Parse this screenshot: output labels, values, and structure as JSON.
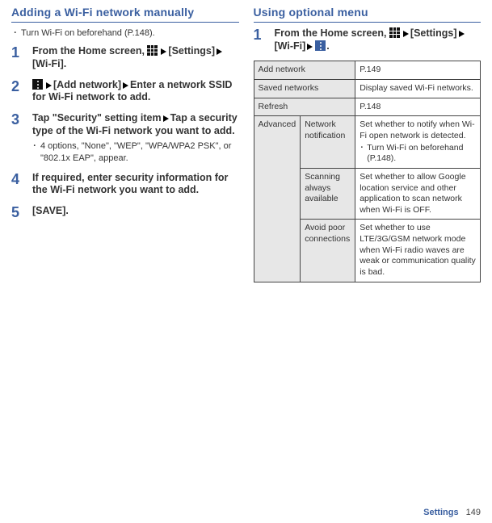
{
  "left": {
    "title": "Adding a Wi-Fi network manually",
    "intro": "Turn Wi-Fi on beforehand (P.148).",
    "steps": [
      {
        "num": "1",
        "fragments": [
          "From the Home screen, ",
          "ICON_GRID",
          "ARROW",
          "[Settings]",
          "ARROW",
          "[Wi-Fi]."
        ]
      },
      {
        "num": "2",
        "fragments": [
          "ICON_MORE",
          "ARROW",
          "[Add network]",
          "ARROW",
          "Enter a network SSID for Wi-Fi network to add."
        ]
      },
      {
        "num": "3",
        "fragments": [
          "Tap \"Security\" setting item",
          "ARROW",
          "Tap a security type of the Wi-Fi network you want to add."
        ],
        "note": "4 options, \"None\", \"WEP\", \"WPA/WPA2 PSK\", or \"802.1x EAP\", appear."
      },
      {
        "num": "4",
        "fragments": [
          "If required, enter security information for the Wi-Fi network you want to add."
        ]
      },
      {
        "num": "5",
        "fragments": [
          "[SAVE]."
        ]
      }
    ]
  },
  "right": {
    "title": "Using optional menu",
    "step": {
      "num": "1",
      "fragments": [
        "From the Home screen, ",
        "ICON_GRID",
        "ARROW",
        "[Settings]",
        "ARROW",
        "[Wi-Fi]",
        "ARROW",
        "ICON_MOREB",
        "."
      ]
    },
    "table": {
      "add_network": "Add network",
      "add_network_val": "P.149",
      "saved_networks": "Saved networks",
      "saved_networks_val": "Display saved Wi-Fi networks.",
      "refresh": "Refresh",
      "refresh_val": "P.148",
      "advanced": "Advanced",
      "adv_netnotif": "Network notification",
      "adv_netnotif_val": "Set whether to notify when Wi-Fi open network is detected.",
      "adv_netnotif_bullet": "Turn Wi-Fi on beforehand (P.148).",
      "adv_scan": "Scanning always available",
      "adv_scan_val": "Set whether to allow Google location service and other application to scan network when Wi-Fi is OFF.",
      "adv_avoid": "Avoid poor connections",
      "adv_avoid_val": "Set whether to use LTE/3G/GSM network mode when Wi-Fi radio waves are weak or communication quality is bad."
    }
  },
  "footer": {
    "section": "Settings",
    "page": "149"
  }
}
